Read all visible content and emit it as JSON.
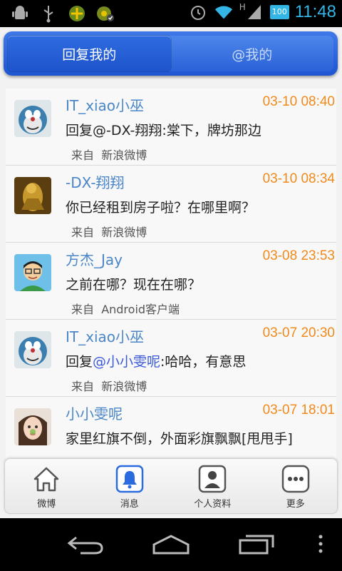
{
  "status_bar": {
    "network": "H",
    "battery": "100",
    "time": "11:48"
  },
  "tabs": [
    {
      "label": "回复我的",
      "active": true
    },
    {
      "label": "@我的",
      "active": false
    }
  ],
  "messages": [
    {
      "user": "IT_xiao小巫",
      "time": "03-10 08:40",
      "content_pre": "回复@-DX-翔翔:棠下，牌坊那边",
      "mention": "",
      "content_post": "",
      "source_prefix": "来自",
      "source": "新浪微博",
      "avatar": "doraemon-avatar"
    },
    {
      "user": "-DX-翔翔",
      "time": "03-10 08:34",
      "content_pre": "你已经租到房子啦？在哪里啊？",
      "mention": "",
      "content_post": "",
      "source_prefix": "来自",
      "source": "新浪微博",
      "avatar": "golden-figure-avatar"
    },
    {
      "user": "方杰_Jay",
      "time": "03-08 23:53",
      "content_pre": "之前在哪？现在在哪？",
      "mention": "",
      "content_post": "",
      "source_prefix": "来自",
      "source": "Android客户端",
      "avatar": "cartoon-man-avatar"
    },
    {
      "user": "IT_xiao小巫",
      "time": "03-07 20:30",
      "content_pre": "回复",
      "mention": "@小小雯呢",
      "content_post": ":哈哈，有意思",
      "source_prefix": "来自",
      "source": "新浪微博",
      "avatar": "doraemon-avatar"
    },
    {
      "user": "小小雯呢",
      "time": "03-07 18:01",
      "content_pre": "家里红旗不倒，外面彩旗飘飘[甩甩手]",
      "mention": "",
      "content_post": "",
      "source_prefix": "",
      "source": "",
      "avatar": "girl-avatar"
    }
  ],
  "bottom_nav": [
    {
      "label": "微博",
      "icon": "home-icon",
      "active": false
    },
    {
      "label": "消息",
      "icon": "bell-icon",
      "active": true
    },
    {
      "label": "个人资料",
      "icon": "profile-icon",
      "active": false
    },
    {
      "label": "更多",
      "icon": "more-icon",
      "active": false
    }
  ],
  "colors": {
    "accent_blue": "#2b62d8",
    "username": "#4a86c8",
    "timestamp": "#f08a1c",
    "status_time": "#33b5e5"
  }
}
